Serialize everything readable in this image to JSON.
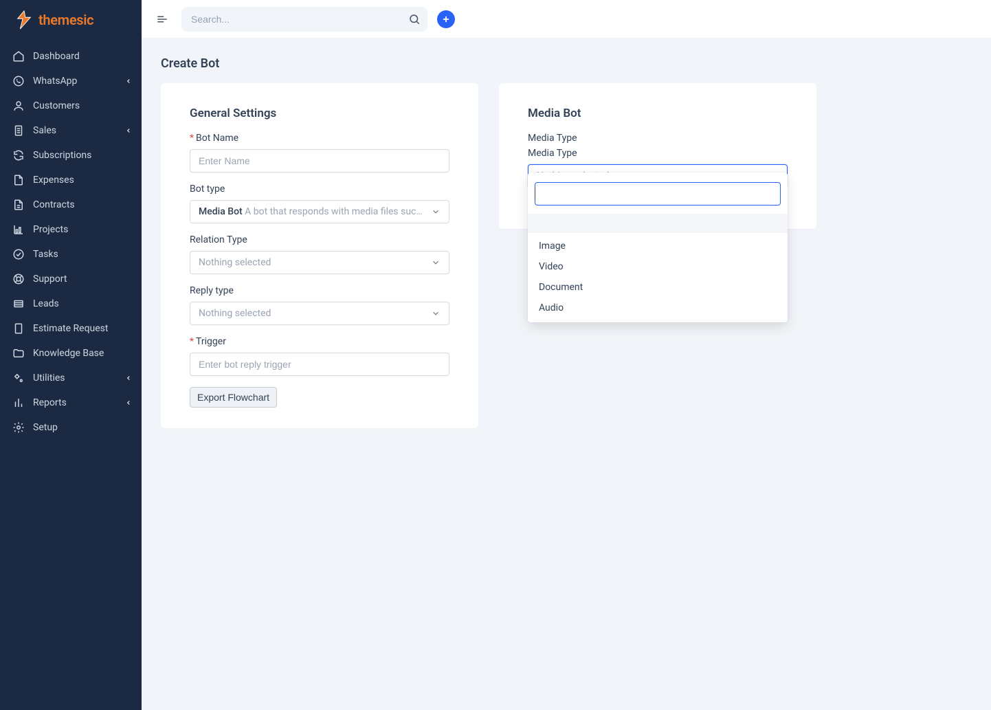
{
  "brand": {
    "name": "themesic"
  },
  "sidebar": {
    "items": [
      {
        "label": "Dashboard",
        "icon": "home",
        "expandable": false
      },
      {
        "label": "WhatsApp",
        "icon": "whatsapp",
        "expandable": true
      },
      {
        "label": "Customers",
        "icon": "user",
        "expandable": false
      },
      {
        "label": "Sales",
        "icon": "receipt",
        "expandable": true
      },
      {
        "label": "Subscriptions",
        "icon": "refresh",
        "expandable": false
      },
      {
        "label": "Expenses",
        "icon": "file",
        "expandable": false
      },
      {
        "label": "Contracts",
        "icon": "document",
        "expandable": false
      },
      {
        "label": "Projects",
        "icon": "chart",
        "expandable": false
      },
      {
        "label": "Tasks",
        "icon": "check-circle",
        "expandable": false
      },
      {
        "label": "Support",
        "icon": "lifebuoy",
        "expandable": false
      },
      {
        "label": "Leads",
        "icon": "inbox",
        "expandable": false
      },
      {
        "label": "Estimate Request",
        "icon": "page",
        "expandable": false
      },
      {
        "label": "Knowledge Base",
        "icon": "folder",
        "expandable": false
      },
      {
        "label": "Utilities",
        "icon": "cogs",
        "expandable": true
      },
      {
        "label": "Reports",
        "icon": "bar-chart",
        "expandable": true
      },
      {
        "label": "Setup",
        "icon": "gear",
        "expandable": false
      }
    ]
  },
  "topbar": {
    "search_placeholder": "Search..."
  },
  "page": {
    "title": "Create Bot"
  },
  "general": {
    "title": "General Settings",
    "bot_name": {
      "label": "Bot Name",
      "placeholder": "Enter Name"
    },
    "bot_type": {
      "label": "Bot type",
      "value_strong": "Media Bot",
      "value_desc": "A bot that responds with media files such as imag..."
    },
    "relation_type": {
      "label": "Relation Type",
      "value": "Nothing selected"
    },
    "reply_type": {
      "label": "Reply type",
      "value": "Nothing selected"
    },
    "trigger": {
      "label": "Trigger",
      "placeholder": "Enter bot reply trigger"
    },
    "export_btn": "Export Flowchart"
  },
  "media": {
    "title": "Media Bot",
    "type_label_1": "Media Type",
    "type_label_2": "Media Type",
    "select_placeholder": "Nothing selected",
    "options": [
      "Image",
      "Video",
      "Document",
      "Audio"
    ]
  }
}
